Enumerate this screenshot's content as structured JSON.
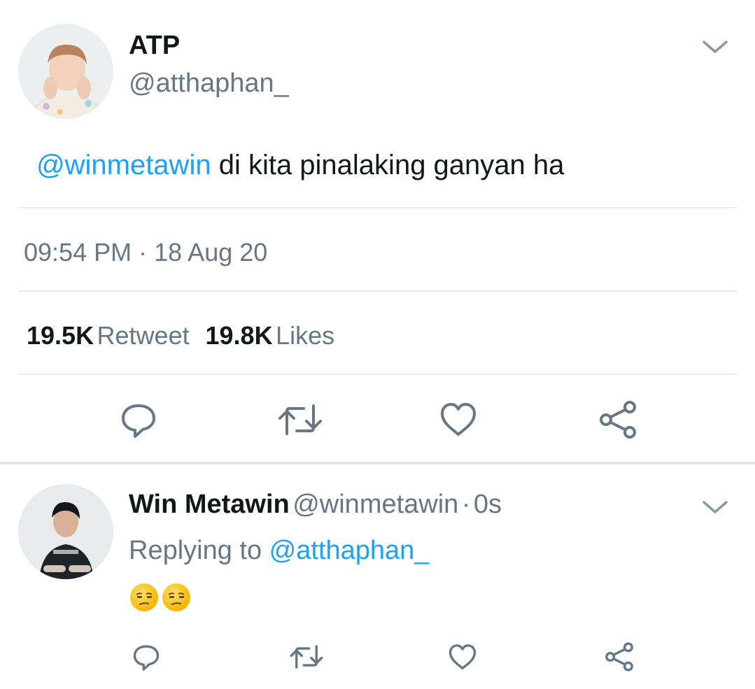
{
  "main_tweet": {
    "display_name": "ATP",
    "handle": "@atthaphan_",
    "mention": "@winmetawin",
    "text": " di kita pinalaking ganyan ha",
    "time": "09:54 PM",
    "separator": "·",
    "date": "18 Aug 20",
    "retweet_count": "19.5K",
    "retweet_label": "Retweet",
    "likes_count": "19.8K",
    "likes_label": "Likes"
  },
  "reply": {
    "display_name": "Win Metawin",
    "handle": "@winmetawin",
    "separator": "·",
    "age": "0s",
    "replying_prefix": "Replying to ",
    "replying_to": "@atthaphan_",
    "emoji_count": 2
  },
  "colors": {
    "link": "#1da1f2",
    "muted": "#657786",
    "text": "#14171a",
    "divider": "#e6ecf0",
    "icon": "#657786"
  },
  "icons": [
    "chevron-down-icon",
    "reply-icon",
    "retweet-icon",
    "like-icon",
    "share-icon",
    "unamused-face-emoji"
  ]
}
